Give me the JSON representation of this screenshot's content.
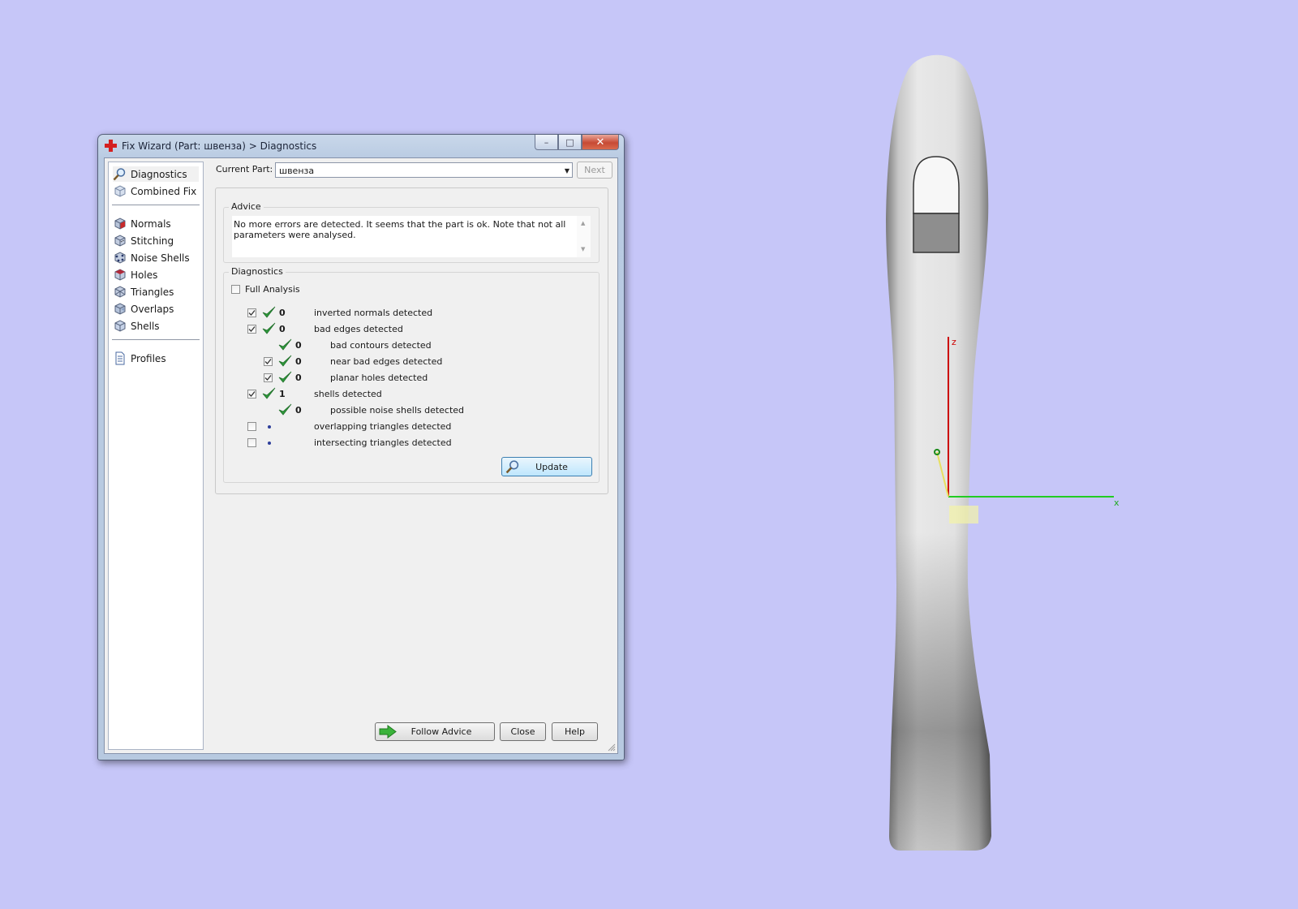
{
  "window": {
    "title": "Fix Wizard (Part: швенза) > Diagnostics",
    "controls": {
      "minimize": "–",
      "maximize": "□",
      "close": "✕"
    }
  },
  "nav": {
    "top": [
      {
        "label": "Diagnostics",
        "icon": "magnifier-icon",
        "selected": true
      },
      {
        "label": "Combined Fix",
        "icon": "cube-icon"
      }
    ],
    "fixes": [
      {
        "label": "Normals",
        "icon": "normals-cube-icon"
      },
      {
        "label": "Stitching",
        "icon": "stitching-cube-icon"
      },
      {
        "label": "Noise Shells",
        "icon": "noise-shells-icon"
      },
      {
        "label": "Holes",
        "icon": "holes-cube-icon"
      },
      {
        "label": "Triangles",
        "icon": "triangles-cube-icon"
      },
      {
        "label": "Overlaps",
        "icon": "overlaps-cube-icon"
      },
      {
        "label": "Shells",
        "icon": "shells-cube-icon"
      }
    ],
    "bottom": [
      {
        "label": "Profiles",
        "icon": "document-icon"
      }
    ]
  },
  "current_part": {
    "label": "Current Part:",
    "value": "швенза"
  },
  "next_button": "Next",
  "advice": {
    "title": "Advice",
    "text": "No more errors are detected. It seems that the part is ok. Note that not all parameters were analysed."
  },
  "diagnostics": {
    "title": "Diagnostics",
    "full_analysis": {
      "label": "Full Analysis",
      "checked": false
    },
    "rows": [
      {
        "checkbox": true,
        "checked": true,
        "status": "ok",
        "count": "0",
        "text": "inverted normals detected",
        "indent": 0
      },
      {
        "checkbox": true,
        "checked": true,
        "status": "ok",
        "count": "0",
        "text": "bad edges detected",
        "indent": 0
      },
      {
        "checkbox": false,
        "checked": false,
        "status": "ok",
        "count": "0",
        "text": "bad contours detected",
        "indent": 1
      },
      {
        "checkbox": true,
        "checked": true,
        "status": "ok",
        "count": "0",
        "text": "near bad edges detected",
        "indent": 1
      },
      {
        "checkbox": true,
        "checked": true,
        "status": "ok",
        "count": "0",
        "text": "planar holes detected",
        "indent": 1
      },
      {
        "checkbox": true,
        "checked": true,
        "status": "ok",
        "count": "1",
        "text": "shells detected",
        "indent": 0
      },
      {
        "checkbox": false,
        "checked": false,
        "status": "ok",
        "count": "0",
        "text": "possible noise shells detected",
        "indent": 1
      },
      {
        "checkbox": true,
        "checked": false,
        "status": "pending",
        "count": "",
        "text": "overlapping triangles detected",
        "indent": 0
      },
      {
        "checkbox": true,
        "checked": false,
        "status": "pending",
        "count": "",
        "text": "intersecting triangles detected",
        "indent": 0
      }
    ],
    "update_button": "Update"
  },
  "footer": {
    "follow_advice": "Follow Advice",
    "close": "Close",
    "help": "Help"
  },
  "viewport": {
    "background": "#c6c6f8",
    "axis_labels": {
      "z": "z",
      "x": "x"
    },
    "colors": {
      "z_axis": "#cc0000",
      "x_axis": "#22cc22",
      "pivot": "#1a8a1a",
      "highlight": "#f4f3a6"
    }
  }
}
